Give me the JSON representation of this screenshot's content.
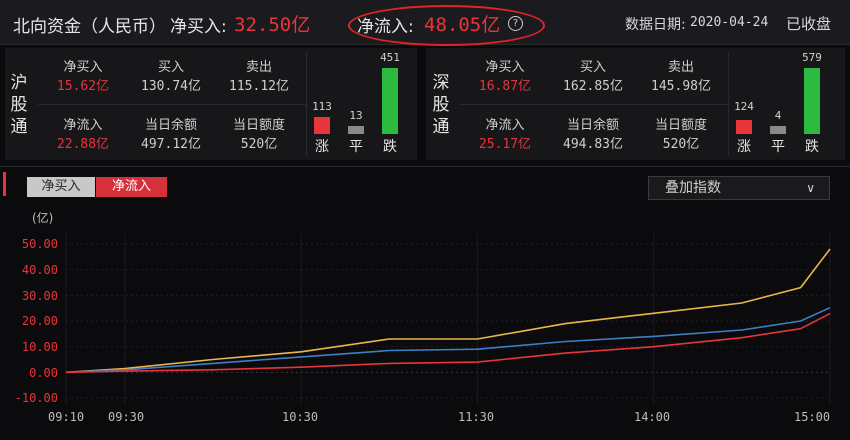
{
  "header": {
    "title": "北向资金（人民币）",
    "net_buy_label": "净买入:",
    "net_buy_value": "32.50亿",
    "net_inflow_label": "净流入:",
    "net_inflow_value": "48.05亿",
    "help_glyph": "?",
    "date_label": "数据日期:",
    "date_value": "2020-04-24",
    "status": "已收盘"
  },
  "sh": {
    "label_chars": [
      "沪",
      "股",
      "通"
    ],
    "net_buy_label": "净买入",
    "net_buy_value": "15.62亿",
    "buy_label": "买入",
    "buy_value": "130.74亿",
    "sell_label": "卖出",
    "sell_value": "115.12亿",
    "net_inflow_label": "净流入",
    "net_inflow_value": "22.88亿",
    "balance_label": "当日余额",
    "balance_value": "497.12亿",
    "quota_label": "当日额度",
    "quota_value": "520亿",
    "up_count": "113",
    "flat_count": "13",
    "down_count": "451",
    "up_label": "涨",
    "flat_label": "平",
    "down_label": "跌",
    "up_value": 113,
    "flat_value": 13,
    "down_value": 451
  },
  "sz": {
    "label_chars": [
      "深",
      "股",
      "通"
    ],
    "net_buy_label": "净买入",
    "net_buy_value": "16.87亿",
    "buy_label": "买入",
    "buy_value": "162.85亿",
    "sell_label": "卖出",
    "sell_value": "145.98亿",
    "net_inflow_label": "净流入",
    "net_inflow_value": "25.17亿",
    "balance_label": "当日余额",
    "balance_value": "494.83亿",
    "quota_label": "当日额度",
    "quota_value": "520亿",
    "up_count": "124",
    "flat_count": "4",
    "down_count": "579",
    "up_label": "涨",
    "flat_label": "平",
    "down_label": "跌",
    "up_value": 124,
    "flat_value": 4,
    "down_value": 579
  },
  "tabs": {
    "net_buy": "净买入",
    "net_inflow": "净流入"
  },
  "dropdown": {
    "label": "叠加指数",
    "chevron": "∨"
  },
  "colors": {
    "red": "#e8343b",
    "green": "#2dbb3f",
    "gold": "#e8b84a",
    "blue": "#3d7fc4",
    "gray": "#8a8a8a"
  },
  "chart_data": {
    "type": "line",
    "ylabel": "(亿)",
    "ylim": [
      -10,
      50
    ],
    "yticks": [
      "50.00",
      "40.00",
      "30.00",
      "20.00",
      "10.00",
      "0.00",
      "-10.00"
    ],
    "xticks": [
      "09:10",
      "09:30",
      "10:30",
      "11:30",
      "14:00",
      "15:00"
    ],
    "x": [
      "09:10",
      "09:30",
      "10:00",
      "10:30",
      "11:00",
      "11:30",
      "13:30",
      "14:00",
      "14:30",
      "14:50",
      "15:00"
    ],
    "series": [
      {
        "color": "#e8b84a",
        "values": [
          0.0,
          1.5,
          5.0,
          8.0,
          13.0,
          13.0,
          19.0,
          23.0,
          27.0,
          33.0,
          48.05
        ]
      },
      {
        "color": "#3d7fc4",
        "values": [
          0.0,
          1.0,
          3.5,
          6.0,
          8.5,
          9.0,
          12.0,
          14.0,
          16.5,
          20.0,
          25.17
        ]
      },
      {
        "color": "#e8343b",
        "values": [
          0.0,
          0.5,
          1.0,
          2.0,
          3.5,
          4.0,
          7.5,
          10.0,
          13.5,
          17.0,
          22.88
        ]
      }
    ]
  }
}
